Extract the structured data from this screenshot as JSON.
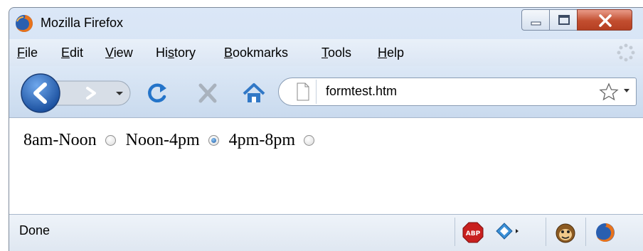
{
  "window": {
    "title": "Mozilla Firefox",
    "app_icon": "firefox-icon"
  },
  "menubar": {
    "items": [
      {
        "accel": "F",
        "rest": "ile"
      },
      {
        "accel": "E",
        "rest": "dit"
      },
      {
        "accel": "V",
        "rest": "iew"
      },
      {
        "pre": "Hi",
        "accel": "s",
        "rest": "tory"
      },
      {
        "accel": "B",
        "rest": "ookmarks"
      },
      {
        "accel": "T",
        "rest": "ools"
      },
      {
        "accel": "H",
        "rest": "elp"
      }
    ]
  },
  "navbar": {
    "url": "formtest.htm",
    "icons": [
      "back-icon",
      "forward-icon",
      "history-dropdown-icon",
      "reload-icon",
      "stop-icon",
      "home-icon",
      "page-icon",
      "bookmark-star-icon",
      "url-dropdown-icon"
    ]
  },
  "content": {
    "options": [
      {
        "label": "8am-Noon",
        "checked": false
      },
      {
        "label": "Noon-4pm",
        "checked": true
      },
      {
        "label": "4pm-8pm",
        "checked": false
      }
    ]
  },
  "statusbar": {
    "text": "Done",
    "icons": [
      "adblock-plus-icon",
      "ie-tab-icon",
      "greasemonkey-icon",
      "firefox-icon"
    ]
  },
  "colors": {
    "chrome": "#c9daee",
    "close_button": "#c24e2f",
    "accent": "#1d5ea8"
  }
}
